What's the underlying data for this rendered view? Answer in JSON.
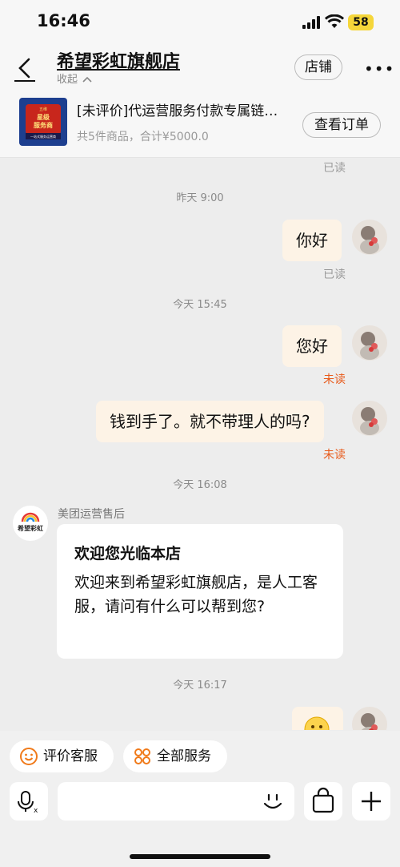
{
  "status_bar": {
    "time": "16:46",
    "battery": "58"
  },
  "header": {
    "shop_name": "希望彩虹旗舰店",
    "collapse_label": "收起",
    "shop_button": "店铺",
    "more": "•••"
  },
  "order": {
    "thumb_lines": [
      "五维",
      "星级",
      "服务商",
      "一站式服务运营商"
    ],
    "name": "[未评价]代运营服务付款专属链…",
    "summary": "共5件商品，合计¥5000.0",
    "view_button": "查看订单"
  },
  "chat": {
    "top_read": "已读",
    "ts1": "昨天 9:00",
    "msg1": "你好",
    "msg1_status": "已读",
    "ts2": "今天 15:45",
    "msg2": "您好",
    "msg2_status": "未读",
    "msg3": "钱到手了。就不带理人的吗?",
    "msg3_status": "未读",
    "ts3": "今天 16:08",
    "seller_name": "美团运营售后",
    "seller_logo": "希望彩虹",
    "card_title": "欢迎您光临本店",
    "card_body": "欢迎来到希望彩虹旗舰店，是人工客服，请问有什么可以帮到您?",
    "ts4": "今天 16:17"
  },
  "quick": {
    "rate": "评价客服",
    "all_services": "全部服务"
  },
  "colors": {
    "bubble": "#fdf3e6",
    "unread": "#e85a1a",
    "accent": "#f07a1a"
  }
}
